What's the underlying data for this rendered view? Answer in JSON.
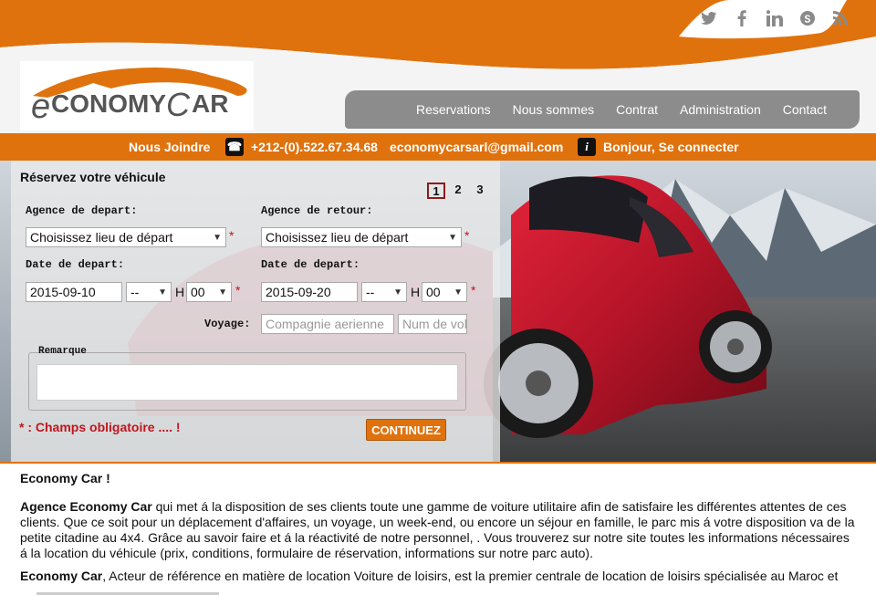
{
  "social": [
    "twitter-icon",
    "facebook-icon",
    "linkedin-icon",
    "skype-icon",
    "rss-icon"
  ],
  "logo": {
    "text_e": "e",
    "text_conomy": "CONOMY",
    "text_c": "C",
    "text_ar": "AR"
  },
  "nav": [
    "Reservations",
    "Nous sommes",
    "Contrat",
    "Administration",
    "Contact"
  ],
  "contact": {
    "join": "Nous Joindre",
    "phone": "+212-(0).522.67.34.68",
    "email": "economycarsarl@gmail.com",
    "login": "Bonjour, Se connecter"
  },
  "form": {
    "title": "Réservez votre véhicule",
    "steps": [
      "1",
      "2",
      "3"
    ],
    "agence_depart_label": "Agence de depart:",
    "agence_retour_label": "Agence de retour:",
    "agence_depart_value": "Choisissez lieu de départ",
    "agence_retour_value": "Choisissez lieu de départ",
    "date_depart_label": "Date de depart:",
    "date_retour_label": "Date de depart:",
    "date_depart_value": "2015-09-10",
    "date_retour_value": "2015-09-20",
    "hour_value": "--",
    "h_label": "H",
    "minute_value": "00",
    "voyage_label": "Voyage:",
    "compagnie_placeholder": "Compagnie aerienne",
    "vol_placeholder": "Num de vol",
    "remarque_label": "Remarque",
    "required_note": "* : Champs obligatoire .... !",
    "star": "*",
    "continue_label": "CONTINUEZ"
  },
  "content": {
    "heading": "Economy Car !",
    "p1_bold": "Agence Economy Car",
    "p1_rest": " qui met á la disposition de ses clients toute une gamme de voiture utilitaire afin de satisfaire les différentes attentes de ces clients. Que ce soit pour un déplacement d'affaires, un voyage, un week-end, ou encore un séjour en famille, le parc mis á votre disposition va de la petite citadine au 4x4. Grâce au savoir faire et á la réactivité de notre personnel, . Vous trouverez sur notre site toutes les informations nécessaires á la location du véhicule (prix, conditions, formulaire de réservation, informations sur notre parc auto).",
    "p2_bold": "Economy Car",
    "p2_rest": ", Acteur de référence en matière de location Voiture de loisirs, est la premier centrale de location de loisirs spécialisée au Maroc et"
  },
  "colors": {
    "orange": "#e0720d",
    "nav_gray": "#8c8c8c",
    "required_red": "#c0161e"
  }
}
